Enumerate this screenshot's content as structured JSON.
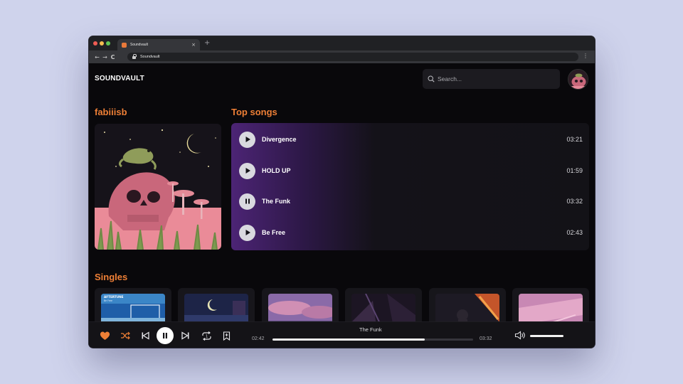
{
  "browser": {
    "tab_title": "Soundvault",
    "close_glyph": "×",
    "new_tab_glyph": "+",
    "url": "Soundvault",
    "back_glyph": "←",
    "forward_glyph": "→",
    "reload_glyph": "C",
    "menu_glyph": "⋮",
    "window_dot_colors": [
      "#ee5c54",
      "#f5bd4f",
      "#5fc454"
    ]
  },
  "header": {
    "logo": "SOUNDVAULT",
    "search_placeholder": "Search..."
  },
  "artist": {
    "name": "fabiiisb"
  },
  "top_songs": {
    "title": "Top songs",
    "songs": [
      {
        "title": "Divergence",
        "duration": "03:21",
        "state": "play"
      },
      {
        "title": "HOLD UP",
        "duration": "01:59",
        "state": "play"
      },
      {
        "title": "The Funk",
        "duration": "03:32",
        "state": "pause"
      },
      {
        "title": "Be Free",
        "duration": "02:43",
        "state": "play"
      }
    ]
  },
  "singles": {
    "title": "Singles",
    "items": [
      {
        "label": "AFTERTUNE",
        "sub": "Be Free"
      }
    ]
  },
  "player": {
    "now_playing": "The Funk",
    "elapsed": "02:42",
    "total": "03:32",
    "progress_pct": 76,
    "volume_pct": 100
  },
  "colors": {
    "accent": "#ee7f36",
    "background": "#09080b",
    "panel": "#17161b",
    "gradient_purple": "#4c2475"
  }
}
